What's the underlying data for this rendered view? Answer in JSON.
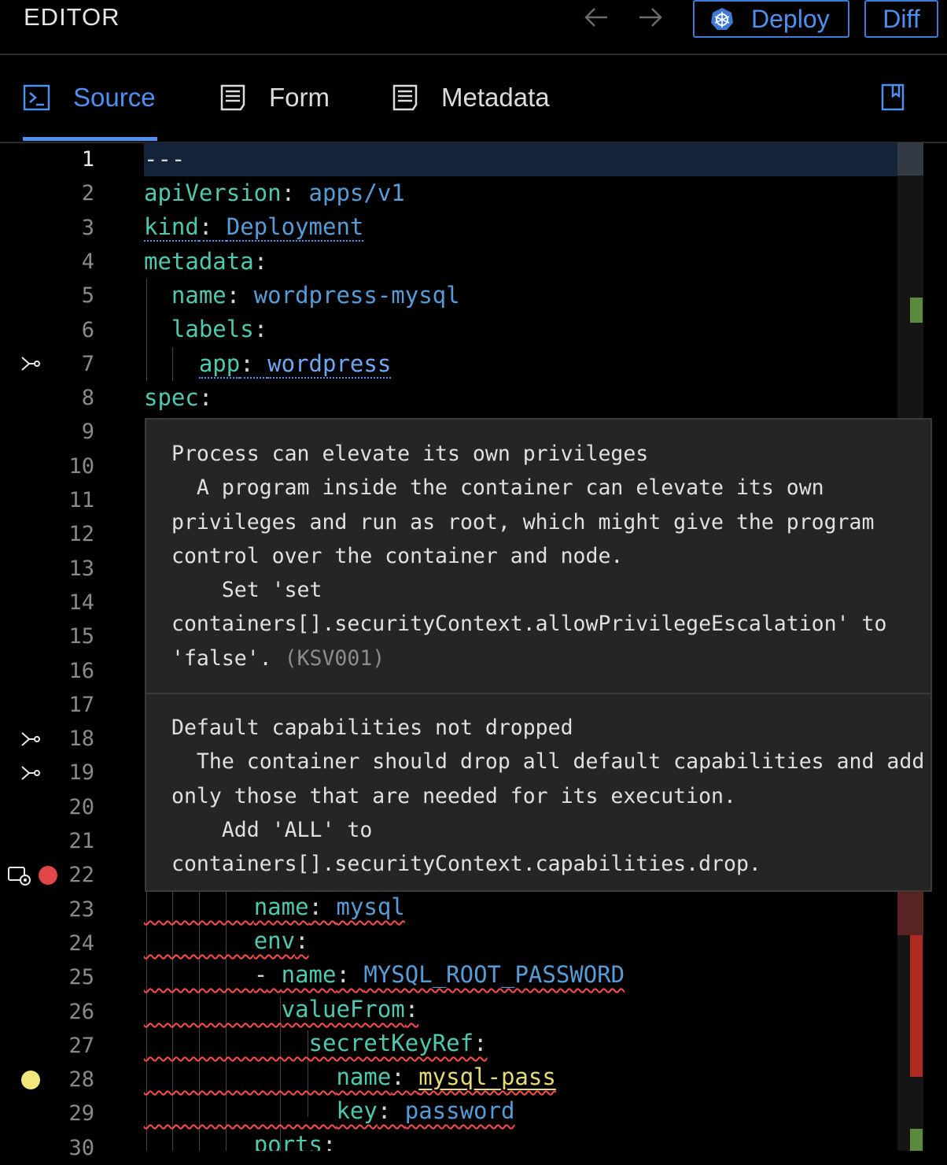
{
  "header": {
    "title": "EDITOR",
    "back_icon": "arrow-left-icon",
    "forward_icon": "arrow-right-icon",
    "deploy_label": "Deploy",
    "deploy_icon": "kubernetes-helm-icon",
    "diff_label": "Diff"
  },
  "tabs": [
    {
      "label": "Source",
      "icon": "terminal-icon",
      "active": true
    },
    {
      "label": "Form",
      "icon": "form-icon",
      "active": false
    },
    {
      "label": "Metadata",
      "icon": "form-icon",
      "active": false
    }
  ],
  "tabs_right_icon": "bookmark-icon",
  "editor": {
    "line_numbers": [
      "1",
      "2",
      "3",
      "4",
      "5",
      "6",
      "7",
      "8",
      "9",
      "10",
      "11",
      "12",
      "13",
      "14",
      "15",
      "16",
      "17",
      "18",
      "19",
      "20",
      "21",
      "22",
      "23",
      "24",
      "25",
      "26",
      "27",
      "28",
      "29",
      "30"
    ],
    "current_line": 1,
    "lines": {
      "l1": "---",
      "l2": {
        "key": "apiVersion",
        "val": "apps/v1"
      },
      "l3": {
        "key": "kind",
        "val": "Deployment"
      },
      "l4": {
        "key": "metadata"
      },
      "l5": {
        "key": "name",
        "val": "wordpress-mysql"
      },
      "l6": {
        "key": "labels"
      },
      "l7": {
        "key": "app",
        "val": "wordpress"
      },
      "l8": {
        "key": "spec"
      },
      "l23": {
        "key": "name",
        "val": "mysql"
      },
      "l24": {
        "key": "env"
      },
      "l25": {
        "dash": "-",
        "key": "name",
        "val": "MYSQL_ROOT_PASSWORD"
      },
      "l26": {
        "key": "valueFrom"
      },
      "l27": {
        "key": "secretKeyRef"
      },
      "l28": {
        "key": "name",
        "val": "mysql-pass"
      },
      "l29": {
        "key": "key",
        "val": "password"
      },
      "l30": {
        "key": "ports"
      }
    },
    "gutter_markers": [
      {
        "line": 7,
        "icon": "git-fork-icon"
      },
      {
        "line": 18,
        "icon": "git-fork-icon"
      },
      {
        "line": 19,
        "icon": "git-fork-icon"
      },
      {
        "line": 22,
        "icon": "breakpoint-error-icon",
        "color": "#e04646"
      },
      {
        "line": 28,
        "icon": "warning-dot-icon",
        "color": "#f2e77a"
      }
    ]
  },
  "hover": {
    "messages": [
      {
        "title": "Process can elevate its own privileges",
        "body": "  A program inside the container can elevate its own privileges and run as root, which might give the program control over the container and node.",
        "fix": "    Set 'set containers[].securityContext.allowPrivilegeEscalation' to 'false'.",
        "code": "(KSV001)"
      },
      {
        "title": "Default capabilities not dropped",
        "body": "  The container should drop all default capabilities and add only those that are needed for its execution.",
        "fix": "    Add 'ALL' to containers[].securityContext.capabilities.drop."
      }
    ]
  },
  "colors": {
    "accent": "#4f8ff0",
    "key": "#4ec9b0",
    "value": "#569cd6",
    "error": "#e04646",
    "warning": "#f2e77a"
  }
}
